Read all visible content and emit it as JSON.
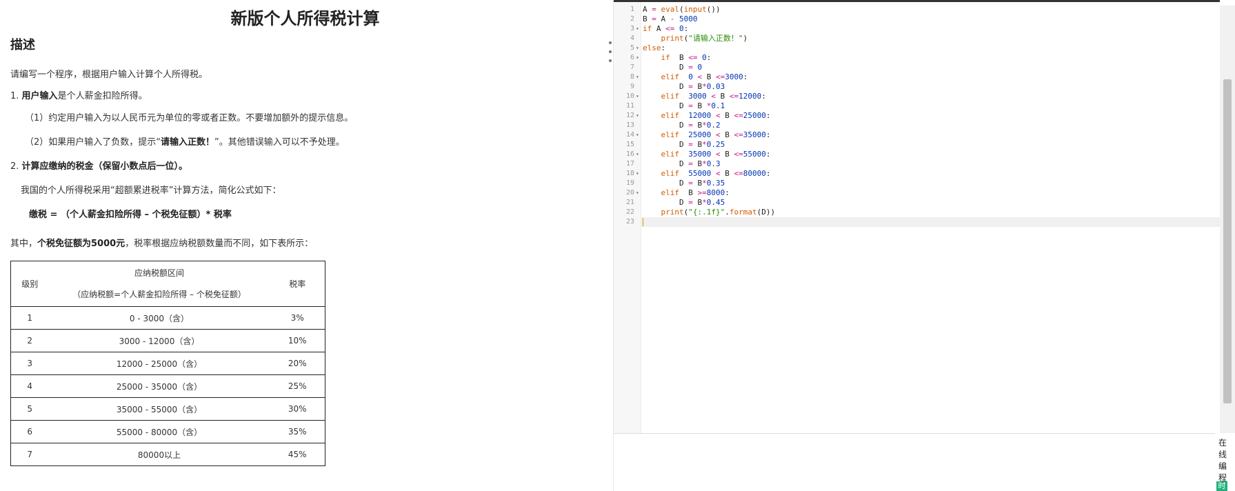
{
  "problem": {
    "title": "新版个人所得税计算",
    "section_heading": "描述",
    "intro": "请编写一个程序，根据用户输入计算个人所得税。",
    "item1_num": "1. ",
    "item1_bold": "用户输入",
    "item1_rest": "是个人薪金扣险所得。",
    "item1_sub1": "（1）约定用户输入为以人民币元为单位的零或者正数。不要增加额外的提示信息。",
    "item1_sub2_a": "（2）如果用户输入了负数，提示“",
    "item1_sub2_bold": "请输入正数！",
    "item1_sub2_b": "”。其他错误输入可以不予处理。",
    "item2_num": "2. ",
    "item2_bold": "计算应缴纳的税金（保留小数点后一位）。",
    "method_text": "我国的个人所得税采用“超额累进税率”计算方法，简化公式如下：",
    "formula": "缴税 = （个人薪金扣险所得 – 个税免征额）* 税率",
    "note_a": "其中，",
    "note_bold": "个税免征额为5000元",
    "note_b": "，税率根据应纳税额数量而不同，如下表所示："
  },
  "tax_table": {
    "headers": {
      "level": "级别",
      "range_line1": "应纳税额区间",
      "range_line2": "（应纳税额=个人薪金扣险所得 – 个税免征额）",
      "rate": "税率"
    },
    "rows": [
      {
        "level": "1",
        "range": "0 - 3000（含）",
        "rate": "3%"
      },
      {
        "level": "2",
        "range": "3000 - 12000（含）",
        "rate": "10%"
      },
      {
        "level": "3",
        "range": "12000 - 25000（含）",
        "rate": "20%"
      },
      {
        "level": "4",
        "range": "25000 - 35000（含）",
        "rate": "25%"
      },
      {
        "level": "5",
        "range": "35000 - 55000（含）",
        "rate": "30%"
      },
      {
        "level": "6",
        "range": "55000 - 80000（含）",
        "rate": "35%"
      },
      {
        "level": "7",
        "range": "80000以上",
        "rate": "45%"
      }
    ]
  },
  "editor": {
    "lines": [
      {
        "n": "1",
        "fold": false,
        "text": "A = eval(input())"
      },
      {
        "n": "2",
        "fold": false,
        "text": "B = A - 5000"
      },
      {
        "n": "3",
        "fold": true,
        "text": "if A <= 0:"
      },
      {
        "n": "4",
        "fold": false,
        "text": "    print(\"请输入正数！\")"
      },
      {
        "n": "5",
        "fold": true,
        "text": "else:"
      },
      {
        "n": "6",
        "fold": true,
        "text": "    if  B <= 0:"
      },
      {
        "n": "7",
        "fold": false,
        "text": "        D = 0"
      },
      {
        "n": "8",
        "fold": true,
        "text": "    elif  0 < B <=3000:"
      },
      {
        "n": "9",
        "fold": false,
        "text": "        D = B*0.03"
      },
      {
        "n": "10",
        "fold": true,
        "text": "    elif  3000 < B <=12000:"
      },
      {
        "n": "11",
        "fold": false,
        "text": "        D = B *0.1"
      },
      {
        "n": "12",
        "fold": true,
        "text": "    elif  12000 < B <=25000:"
      },
      {
        "n": "13",
        "fold": false,
        "text": "        D = B*0.2"
      },
      {
        "n": "14",
        "fold": true,
        "text": "    elif  25000 < B <=35000:"
      },
      {
        "n": "15",
        "fold": false,
        "text": "        D = B*0.25"
      },
      {
        "n": "16",
        "fold": true,
        "text": "    elif  35000 < B <=55000:"
      },
      {
        "n": "17",
        "fold": false,
        "text": "        D = B*0.3"
      },
      {
        "n": "18",
        "fold": true,
        "text": "    elif  55000 < B <=80000:"
      },
      {
        "n": "19",
        "fold": false,
        "text": "        D = B*0.35"
      },
      {
        "n": "20",
        "fold": true,
        "text": "    elif  B >=8000:"
      },
      {
        "n": "21",
        "fold": false,
        "text": "        D = B*0.45"
      },
      {
        "n": "22",
        "fold": false,
        "text": "    print(\"{:.1f}\".format(D))"
      },
      {
        "n": "23",
        "fold": false,
        "text": ""
      }
    ],
    "active_line": "23"
  },
  "output_panel": {
    "side_label": [
      "在",
      "线",
      "编",
      "程"
    ],
    "side_tab": "时"
  },
  "colors": {
    "keyword": "#d25b00",
    "string": "#2a8c0a",
    "number": "#0033b3",
    "accent_green": "#23b27d"
  }
}
